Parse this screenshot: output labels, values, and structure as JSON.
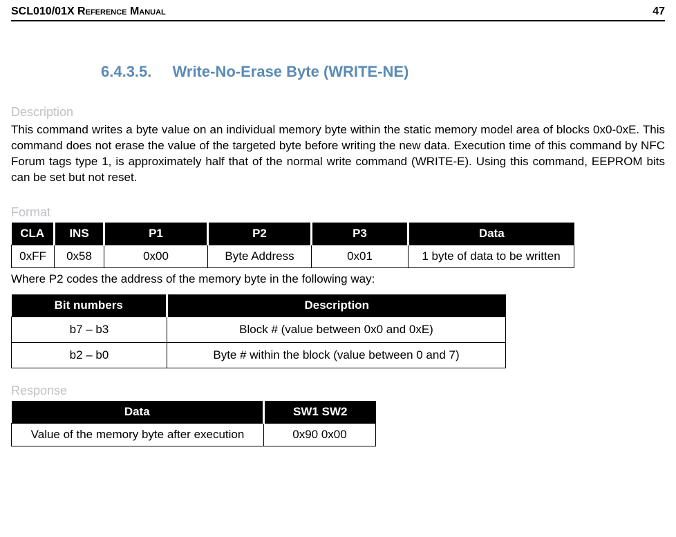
{
  "header": {
    "title": "SCL010/01X Reference Manual",
    "page": "47"
  },
  "section": {
    "number": "6.4.3.5.",
    "title": "Write-No-Erase Byte (WRITE-NE)"
  },
  "description": {
    "heading": "Description",
    "text": "This command writes a byte value on an individual memory byte within the static memory model area of blocks 0x0-0xE. This command does not erase the value of the targeted byte before writing the new data. Execution time of this command by NFC Forum tags type 1, is approximately half that of the normal write command (WRITE-E). Using this command, EEPROM bits can be set but not reset."
  },
  "format": {
    "heading": "Format",
    "headers": [
      "CLA",
      "INS",
      "P1",
      "P2",
      "P3",
      "Data"
    ],
    "row": {
      "cla": "0xFF",
      "ins": "0x58",
      "p1": "0x00",
      "p2": "Byte Address",
      "p3": "0x01",
      "data": "1 byte of data to be written"
    },
    "where_text": "Where P2 codes the address of the memory byte in the following way:",
    "bits_headers": [
      "Bit numbers",
      "Description"
    ],
    "bits_rows": [
      {
        "bits": "b7 – b3",
        "desc": "Block # (value between 0x0 and 0xE)"
      },
      {
        "bits": "b2 – b0",
        "desc": "Byte # within the block (value between 0 and 7)"
      }
    ]
  },
  "response": {
    "heading": "Response",
    "headers": [
      "Data",
      "SW1 SW2"
    ],
    "row": {
      "data": "Value of the memory byte after execution",
      "sw": "0x90 0x00"
    }
  }
}
